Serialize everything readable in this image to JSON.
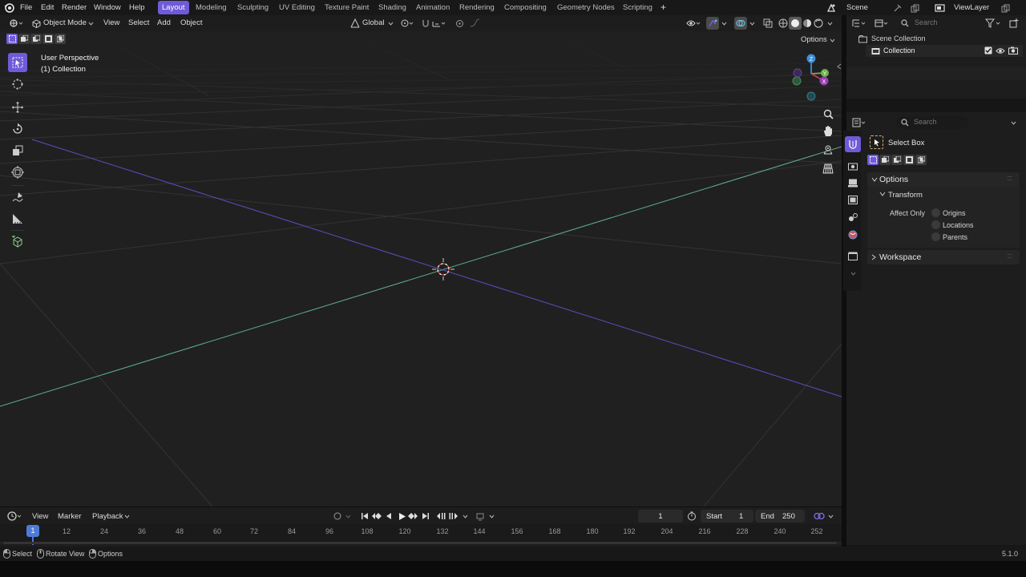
{
  "app": {
    "version": "5.1.0"
  },
  "topbar": {
    "menus": [
      "File",
      "Edit",
      "Render",
      "Window",
      "Help"
    ],
    "workspaces": [
      "Layout",
      "Modeling",
      "Sculpting",
      "UV Editing",
      "Texture Paint",
      "Shading",
      "Animation",
      "Rendering",
      "Compositing",
      "Geometry Nodes",
      "Scripting"
    ],
    "active_workspace": "Layout",
    "scene": "Scene",
    "view_layer": "ViewLayer"
  },
  "viewport_header": {
    "mode": "Object Mode",
    "menus": [
      "View",
      "Select",
      "Add",
      "Object"
    ],
    "transform_orientation": "Global",
    "options_label": "Options"
  },
  "viewport": {
    "perspective_label": "User Perspective",
    "collection_label": "(1) Collection",
    "gizmo_axes": [
      "Z",
      "Y",
      "X"
    ]
  },
  "outliner": {
    "search_placeholder": "Search",
    "scene_collection": "Scene Collection",
    "collection": "Collection"
  },
  "properties": {
    "search_placeholder": "Search",
    "tool_name": "Select Box",
    "options_panel": "Options",
    "transform_subpanel": "Transform",
    "affect_only_label": "Affect Only",
    "affect_options": [
      "Origins",
      "Locations",
      "Parents"
    ],
    "workspace_panel": "Workspace"
  },
  "timeline": {
    "menus": [
      "View",
      "Marker",
      "Playback"
    ],
    "current_frame": "1",
    "start_label": "Start",
    "start_value": "1",
    "end_label": "End",
    "end_value": "250",
    "ticks": [
      "12",
      "24",
      "36",
      "48",
      "60",
      "72",
      "84",
      "96",
      "108",
      "120",
      "132",
      "144",
      "156",
      "168",
      "180",
      "192",
      "204",
      "216",
      "228",
      "240",
      "252"
    ],
    "playhead_label": "1"
  },
  "statusbar": {
    "items": [
      "Select",
      "Rotate View",
      "Options"
    ]
  },
  "colors": {
    "accent": "#6f5bd8",
    "x_axis": "#c8375a",
    "y_axis": "#6fb34a",
    "z_axis": "#3d8fd6",
    "grid_green": "#5fae8c",
    "grid_blue": "#5a4fc4"
  }
}
